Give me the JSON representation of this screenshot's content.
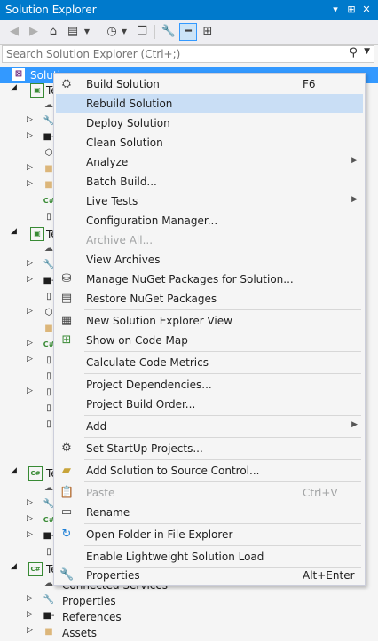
{
  "window": {
    "title": "Solution Explorer",
    "buttons": [
      "▾",
      "⊞",
      "✕"
    ]
  },
  "toolbar": {
    "icons": [
      "back-icon",
      "forward-icon",
      "home-icon",
      "switch-views-icon",
      "pending-changes-filter-icon",
      "collapse-all-icon",
      "properties-icon",
      "preview-selected-icon",
      "class-view-icon"
    ]
  },
  "search": {
    "placeholder": "Search Solution Explorer (Ctrl+;)"
  },
  "tree": {
    "rows": [
      {
        "label": "Soluti"
      },
      {
        "label": "Te"
      },
      {
        "label": "Te"
      },
      {
        "label": "Te"
      },
      {
        "label": "Te"
      },
      {
        "label": "Connected Services"
      },
      {
        "label": "Properties"
      },
      {
        "label": "References"
      },
      {
        "label": "Assets"
      }
    ]
  },
  "menu": {
    "items": [
      {
        "label": "Build Solution",
        "shortcut": "F6",
        "icon": "build-icon"
      },
      {
        "label": "Rebuild Solution"
      },
      {
        "label": "Deploy Solution"
      },
      {
        "label": "Clean Solution"
      },
      {
        "label": "Analyze",
        "submenu": true
      },
      {
        "label": "Batch Build..."
      },
      {
        "label": "Live Tests",
        "submenu": true
      },
      {
        "label": "Configuration Manager..."
      },
      {
        "label": "Archive All...",
        "disabled": true
      },
      {
        "label": "View Archives"
      },
      {
        "label": "Manage NuGet Packages for Solution...",
        "icon": "nuget-icon"
      },
      {
        "label": "Restore NuGet Packages",
        "icon": "restore-icon"
      },
      {
        "label": "New Solution Explorer View",
        "icon": "new-view-icon"
      },
      {
        "label": "Show on Code Map",
        "icon": "code-map-icon"
      },
      {
        "label": "Calculate Code Metrics"
      },
      {
        "label": "Project Dependencies..."
      },
      {
        "label": "Project Build Order..."
      },
      {
        "label": "Add",
        "submenu": true
      },
      {
        "label": "Set StartUp Projects...",
        "icon": "gear-icon"
      },
      {
        "label": "Add Solution to Source Control...",
        "icon": "source-control-icon"
      },
      {
        "label": "Paste",
        "shortcut": "Ctrl+V",
        "disabled": true,
        "icon": "paste-icon"
      },
      {
        "label": "Rename",
        "icon": "rename-icon"
      },
      {
        "label": "Open Folder in File Explorer",
        "icon": "open-folder-icon"
      },
      {
        "label": "Enable Lightweight Solution Load"
      },
      {
        "label": "Properties",
        "shortcut": "Alt+Enter",
        "icon": "wrench-icon"
      }
    ]
  },
  "colors": {
    "accent": "#007acc",
    "selection": "#3399ff",
    "menu_highlight": "#c9def5"
  }
}
